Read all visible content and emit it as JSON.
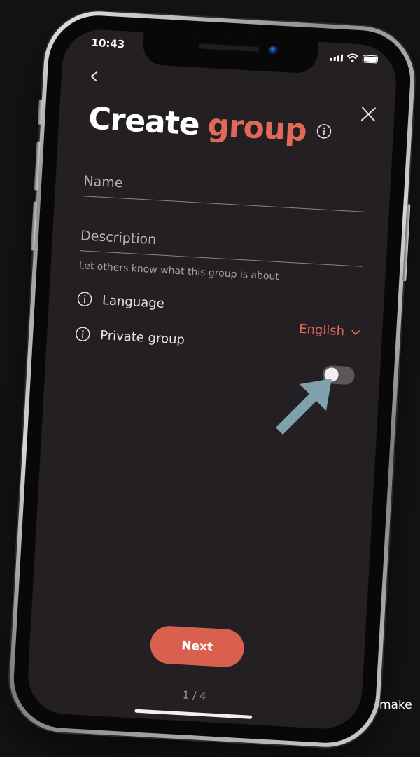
{
  "status_bar": {
    "time": "10:43"
  },
  "header": {
    "title_primary": "Create",
    "title_accent": "group"
  },
  "form": {
    "name": {
      "placeholder": "Name",
      "value": ""
    },
    "description": {
      "placeholder": "Description",
      "value": "",
      "hint": "Let others know what this group is about"
    },
    "language": {
      "label": "Language",
      "selected": "English"
    },
    "private_group": {
      "label": "Private group",
      "enabled": false
    }
  },
  "footer": {
    "next_label": "Next",
    "pager": "1 / 4"
  },
  "caption": "make",
  "colors": {
    "accent": "#e0695a",
    "button": "#d9604f",
    "screen_bg": "#231f22",
    "overlay_arrow": "#7fa1ab"
  },
  "icons": [
    "back-icon",
    "close-icon",
    "info-icon",
    "chevron-down-icon",
    "signal-icon",
    "wifi-icon",
    "battery-icon",
    "arrow-pointer-icon"
  ]
}
